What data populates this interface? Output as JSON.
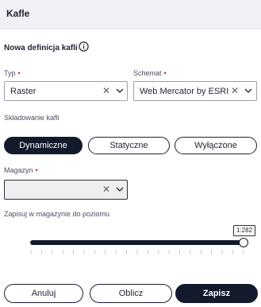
{
  "panel": {
    "title": "Kafle"
  },
  "section": {
    "title": "Nowa definicja kafli"
  },
  "typ": {
    "label": "Typ",
    "required_mark": "•",
    "value": "Raster"
  },
  "schemat": {
    "label": "Schemat",
    "required_mark": "•",
    "value": "Web Mercator by ESRI"
  },
  "storage": {
    "label": "Składowanie kafli",
    "options": [
      "Dynamiczne",
      "Statyczne",
      "Wyłączone"
    ],
    "selected": "Dynamiczne"
  },
  "magazyn": {
    "label": "Magazyn",
    "required_mark": "•",
    "value": ""
  },
  "level": {
    "label": "Zapisuj w magazynie do poziomu",
    "tooltip": "1:282",
    "value_fraction": 0.97
  },
  "footer": {
    "cancel": "Anuluj",
    "calculate": "Oblicz",
    "save": "Zapisz"
  },
  "colors": {
    "primary": "#131a2b",
    "required": "#c0243b",
    "header_bg": "#f0f1f4"
  },
  "icons": {
    "info": "info-icon",
    "clear": "close-icon",
    "dropdown": "chevron-down-icon"
  }
}
